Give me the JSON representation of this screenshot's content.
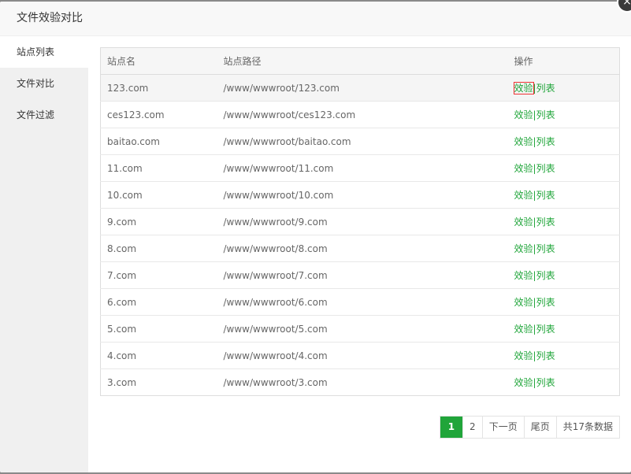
{
  "dialog": {
    "title": "文件效验对比",
    "close_glyph": "×"
  },
  "sidebar": {
    "items": [
      {
        "label": "站点列表"
      },
      {
        "label": "文件对比"
      },
      {
        "label": "文件过滤"
      }
    ]
  },
  "table": {
    "headers": [
      "站点名",
      "站点路径",
      "操作"
    ],
    "rows": [
      {
        "name": "123.com",
        "path": "/www/wwwroot/123.com"
      },
      {
        "name": "ces123.com",
        "path": "/www/wwwroot/ces123.com"
      },
      {
        "name": "baitao.com",
        "path": "/www/wwwroot/baitao.com"
      },
      {
        "name": "11.com",
        "path": "/www/wwwroot/11.com"
      },
      {
        "name": "10.com",
        "path": "/www/wwwroot/10.com"
      },
      {
        "name": "9.com",
        "path": "/www/wwwroot/9.com"
      },
      {
        "name": "8.com",
        "path": "/www/wwwroot/8.com"
      },
      {
        "name": "7.com",
        "path": "/www/wwwroot/7.com"
      },
      {
        "name": "6.com",
        "path": "/www/wwwroot/6.com"
      },
      {
        "name": "5.com",
        "path": "/www/wwwroot/5.com"
      },
      {
        "name": "4.com",
        "path": "/www/wwwroot/4.com"
      },
      {
        "name": "3.com",
        "path": "/www/wwwroot/3.com"
      }
    ],
    "actions": {
      "verify": "效验",
      "separator": "|",
      "list": "列表"
    }
  },
  "pager": {
    "pages": [
      "1",
      "2"
    ],
    "next": "下一页",
    "last": "尾页",
    "total": "共17条数据"
  },
  "colors": {
    "accent": "#20a53a",
    "highlight_border": "#e33333"
  }
}
